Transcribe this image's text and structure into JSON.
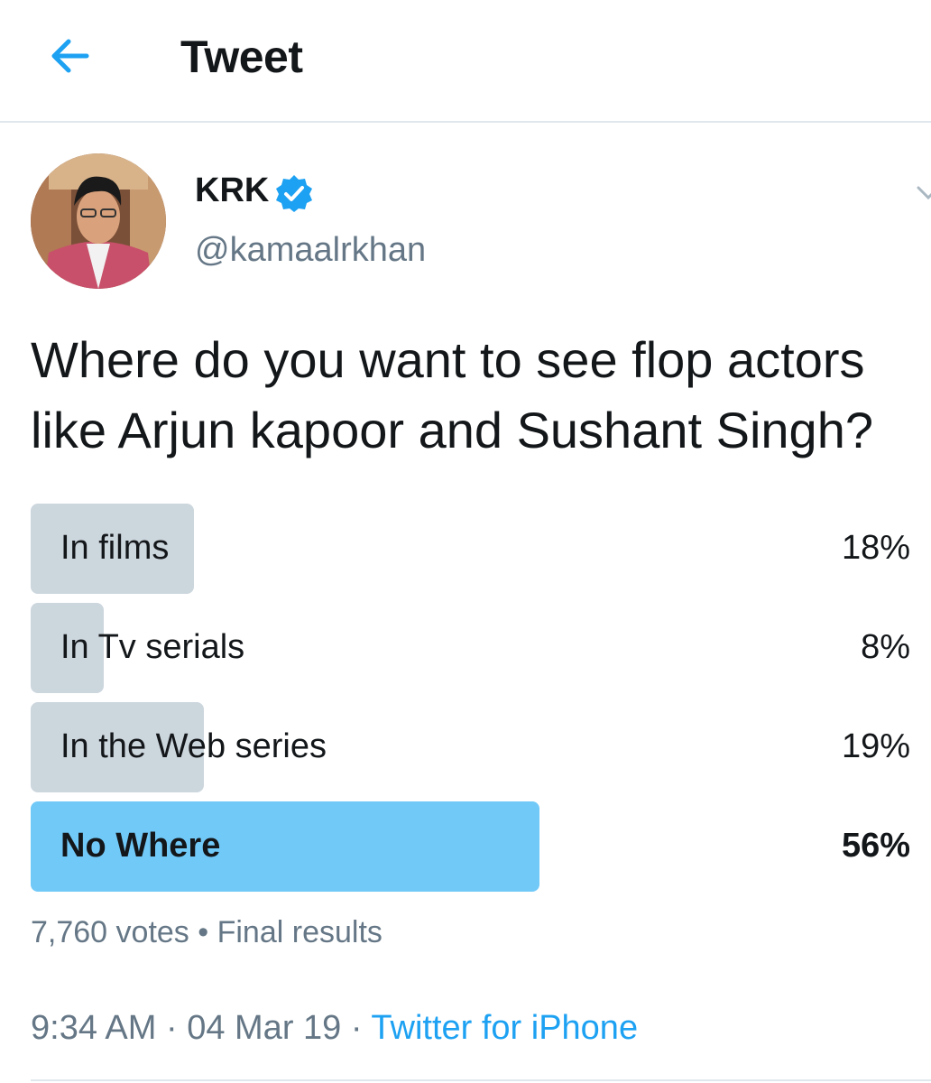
{
  "header": {
    "title": "Tweet",
    "back_icon": "back-arrow-icon"
  },
  "colors": {
    "accent": "#1da1f2",
    "winner_bar": "#71c9f8",
    "loser_bar": "#ccd6dd",
    "muted_text": "#657786"
  },
  "tweet": {
    "display_name": "KRK",
    "verified": true,
    "handle": "@kamaalrkhan",
    "text_lines": [
      "Where do you want to see flop actors",
      "like Arjun kapoor and Sushant Singh?"
    ]
  },
  "poll": {
    "options": [
      {
        "label": "In films",
        "percent_text": "18%",
        "percent": 18,
        "winner": false
      },
      {
        "label": "In Tv serials",
        "percent_text": "8%",
        "percent": 8,
        "winner": false
      },
      {
        "label": "In the Web series",
        "percent_text": "19%",
        "percent": 19,
        "winner": false
      },
      {
        "label": "No Where",
        "percent_text": "56%",
        "percent": 56,
        "winner": true
      }
    ],
    "votes": "7,760 votes",
    "separator": "•",
    "status": "Final results"
  },
  "meta": {
    "time": "9:34 AM",
    "date": "04 Mar 19",
    "separator": "·",
    "source": "Twitter for iPhone"
  }
}
